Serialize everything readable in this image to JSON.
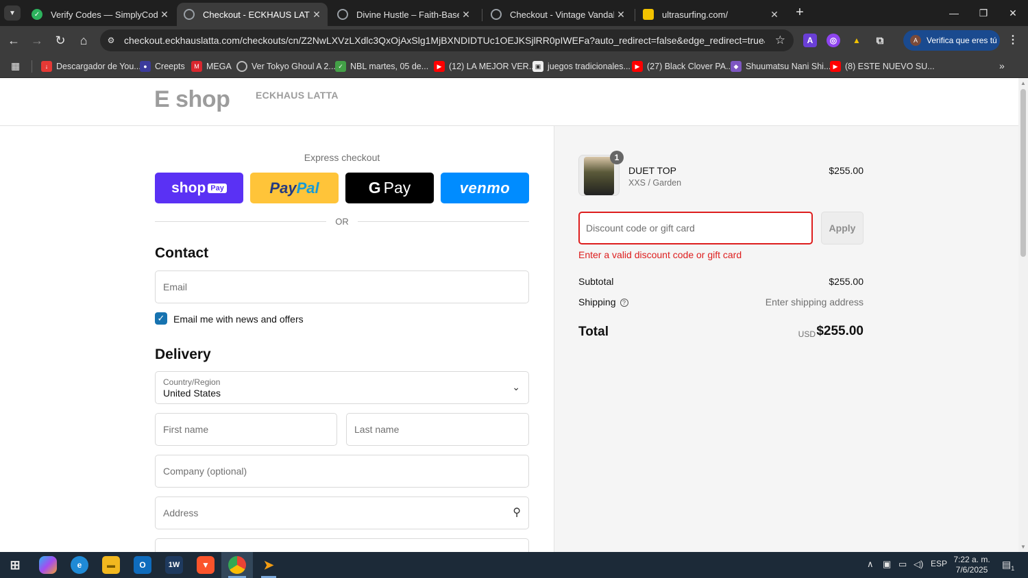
{
  "browser": {
    "tabs": [
      {
        "title": "Verify Codes — SimplyCodes",
        "favicon_color": "#2db35d",
        "active": false
      },
      {
        "title": "Checkout - ECKHAUS LATTA",
        "favicon_color": "#9aa0a6",
        "active": true
      },
      {
        "title": "Divine Hustle – Faith-Based Ent",
        "favicon_color": "#9aa0a6",
        "active": false
      },
      {
        "title": "Checkout - Vintage Vandalizm",
        "favicon_color": "#9aa0a6",
        "active": false
      },
      {
        "title": "ultrasurfing.com/",
        "favicon_color": "#f2c200",
        "active": false
      }
    ],
    "url": "checkout.eckhauslatta.com/checkouts/cn/Z2NwLXVzLXdlc3QxOjAxSlg1MjBXNDIDTUc1OEJKSjlRR0pIWEFa?auto_redirect=false&edge_redirect=true&locale=en-",
    "profile_label": "Verifica que eres tú",
    "bookmarks": [
      {
        "label": "Descargador de You...",
        "color": "#e53935"
      },
      {
        "label": "Creepts",
        "color": "#3b3b9c"
      },
      {
        "label": "MEGA",
        "color": "#d9272e"
      },
      {
        "label": "Ver Tokyo Ghoul A 2...",
        "color": "#666666"
      },
      {
        "label": "NBL martes, 05 de...",
        "color": "#43a047"
      },
      {
        "label": "(12) LA MEJOR VER...",
        "color": "#ff0000"
      },
      {
        "label": "juegos tradicionales...",
        "color": "#777777"
      },
      {
        "label": "(27) Black Clover PA...",
        "color": "#ff0000"
      },
      {
        "label": "Shuumatsu Nani Shi...",
        "color": "#7e57c2"
      },
      {
        "label": "(8) ESTE NUEVO SU...",
        "color": "#ff0000"
      }
    ]
  },
  "store": {
    "logo_main": "E shop",
    "logo_brand": "ECKHAUS LATTA"
  },
  "checkout": {
    "express_label": "Express checkout",
    "shop_pay": "shop",
    "shop_pay_pill": "Pay",
    "paypal_a": "Pay",
    "paypal_b": "Pal",
    "gpay_g": "G",
    "gpay_text": "Pay",
    "venmo": "venmo",
    "or_text": "OR",
    "contact_heading": "Contact",
    "email_placeholder": "Email",
    "news_label": "Email me with news and offers",
    "news_checked": true,
    "delivery_heading": "Delivery",
    "country_label": "Country/Region",
    "country_value": "United States",
    "first_name_placeholder": "First name",
    "last_name_placeholder": "Last name",
    "company_placeholder": "Company (optional)",
    "address_placeholder": "Address"
  },
  "summary": {
    "item": {
      "name": "DUET TOP",
      "variant": "XXS / Garden",
      "price": "$255.00",
      "quantity": "1"
    },
    "discount_placeholder": "Discount code or gift card",
    "apply_label": "Apply",
    "discount_error": "Enter a valid discount code or gift card",
    "subtotal_label": "Subtotal",
    "subtotal_value": "$255.00",
    "shipping_label": "Shipping",
    "shipping_value": "Enter shipping address",
    "total_label": "Total",
    "total_currency": "USD",
    "total_value": "$255.00",
    "error_color": "#dd1d1d"
  },
  "taskbar": {
    "language": "ESP",
    "time": "7:22 a. m.",
    "date": "7/6/2025",
    "notification_count": "1"
  }
}
